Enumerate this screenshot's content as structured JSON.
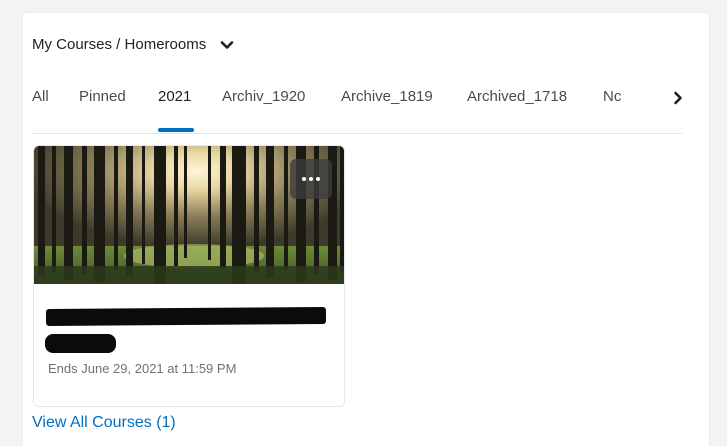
{
  "header": {
    "title": "My Courses / Homerooms",
    "icon": "chevron-down-icon"
  },
  "tabs": [
    {
      "label": "All",
      "active": false
    },
    {
      "label": "Pinned",
      "active": false
    },
    {
      "label": "2021",
      "active": true
    },
    {
      "label": "Archiv_1920",
      "active": false
    },
    {
      "label": "Archive_1819",
      "active": false
    },
    {
      "label": "Archived_1718",
      "active": false
    },
    {
      "label": "Nc",
      "active": false
    }
  ],
  "tabs_next_icon": "chevron-right-icon",
  "course_card": {
    "image": "forest-image",
    "menu_icon": "more-options-icon",
    "name": "[redacted]",
    "code": "[redacted]",
    "end_date": "Ends June 29, 2021 at 11:59 PM"
  },
  "view_all_link": "View All Courses (1)",
  "colors": {
    "accent": "#006fbf",
    "tab_divider": "#e3e9f1",
    "muted_text": "#6e7376"
  }
}
